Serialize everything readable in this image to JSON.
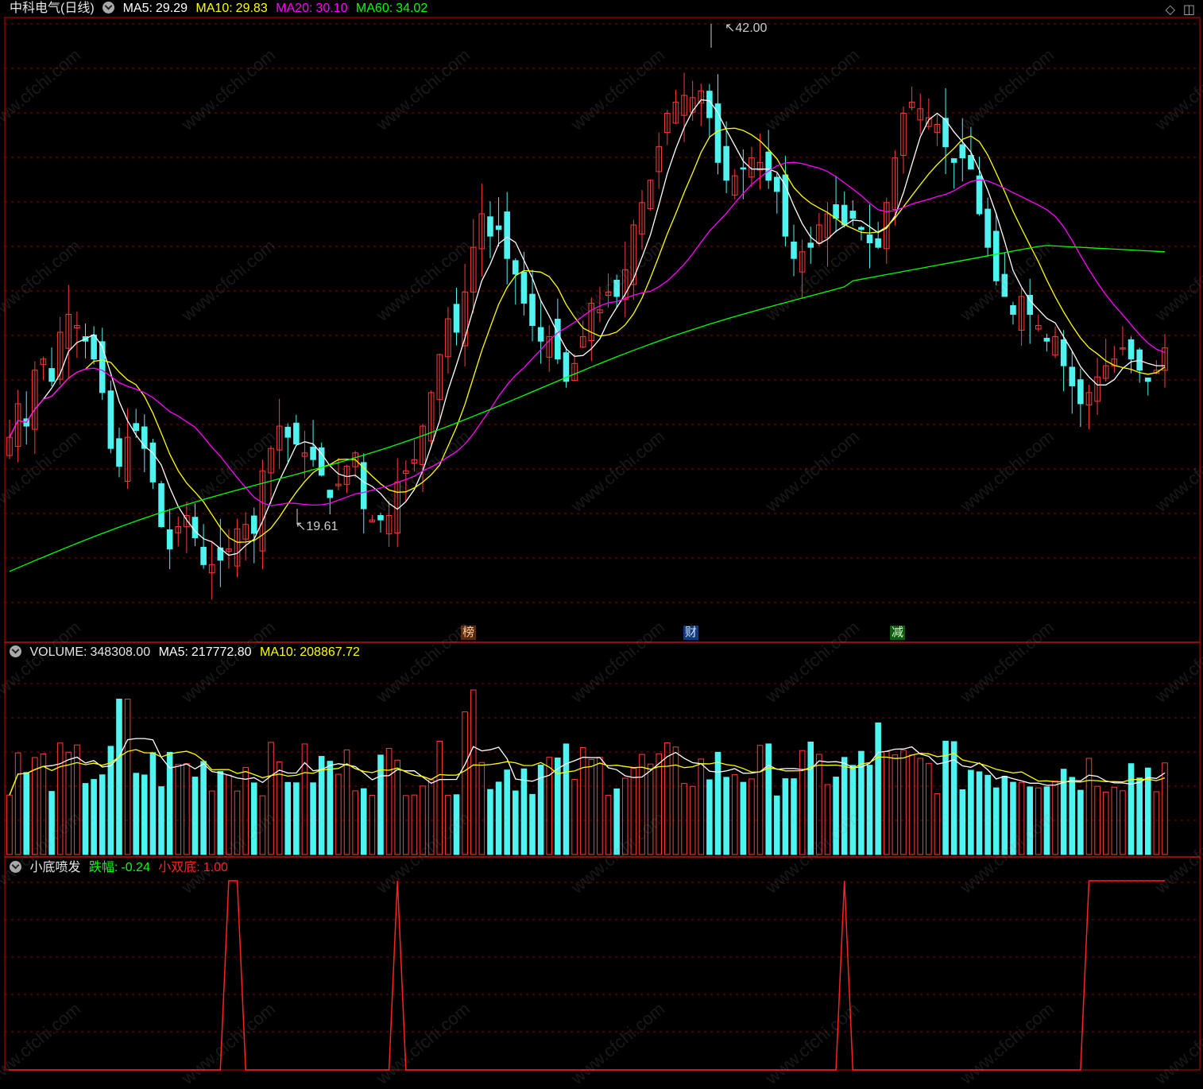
{
  "stock": {
    "title": "中科电气(日线)",
    "ma5_label": "MA5:",
    "ma5_value": "29.29",
    "ma10_label": "MA10:",
    "ma10_value": "29.83",
    "ma20_label": "MA20:",
    "ma20_value": "30.10",
    "ma60_label": "MA60:",
    "ma60_value": "34.02"
  },
  "volume": {
    "label": "VOLUME:",
    "value": "348308.00",
    "ma5_label": "MA5:",
    "ma5_value": "217772.80",
    "ma10_label": "MA10:",
    "ma10_value": "208867.72"
  },
  "indicator": {
    "name": "小底喷发",
    "drop_label": "跌幅:",
    "drop_value": "-0.24",
    "double_label": "小双底:",
    "double_value": "1.00"
  },
  "annotations": {
    "high": "42.00",
    "low": "19.61",
    "tag1": "榜",
    "tag2": "财",
    "tag3": "减"
  },
  "watermark": "www.cfchi.com",
  "colors": {
    "up": "#ff3a3a",
    "down": "#4ef4f0",
    "ma5": "#ffffff",
    "ma10": "#ffff00",
    "ma20": "#ff00ff",
    "ma60": "#00ff00",
    "grid": "#8b0000",
    "signal": "#ff2020"
  },
  "chart_data": {
    "type": "candlestick",
    "price_range": [
      19.61,
      42.0
    ],
    "closes": [
      25.5,
      27.0,
      26.0,
      28.5,
      29.0,
      28.0,
      30.2,
      31.0,
      30.5,
      29.8,
      29.0,
      27.5,
      25.0,
      24.2,
      25.5,
      25.8,
      25.0,
      23.5,
      21.5,
      20.5,
      21.5,
      22.0,
      21.0,
      19.8,
      19.8,
      20.0,
      20.5,
      21.4,
      21.6,
      21.2,
      24.0,
      25.0,
      26.0,
      25.5,
      25.2,
      24.8,
      24.5,
      23.8,
      22.8,
      23.4,
      24.2,
      24.8,
      22.3,
      21.8,
      21.8,
      22.0,
      23.5,
      24.0,
      24.5,
      26.0,
      27.5,
      29.2,
      30.8,
      30.2,
      32.0,
      34.0,
      35.5,
      34.5,
      34.8,
      33.5,
      32.8,
      31.5,
      30.5,
      29.8,
      30.0,
      29.0,
      28.0,
      28.8,
      30.0,
      31.5,
      31.2,
      32.0,
      31.8,
      33.0,
      35.0,
      36.0,
      37.0,
      38.5,
      40.0,
      40.5,
      40.8,
      40.7,
      41.0,
      39.8,
      37.8,
      37.0,
      37.2,
      37.5,
      38.0,
      37.8,
      37.0,
      36.5,
      34.5,
      33.5,
      33.8,
      34.0,
      35.0,
      35.5,
      35.3,
      35.0,
      35.3,
      34.8,
      34.2,
      34.0,
      36.0,
      38.0,
      40.0,
      40.5,
      40.2,
      39.8,
      39.5,
      38.5,
      37.8,
      38.0,
      37.5,
      35.5,
      34.0,
      32.5,
      31.8,
      31.0,
      31.8,
      31.0,
      30.5,
      29.8,
      30.0,
      28.7,
      27.8,
      27.0,
      27.5,
      28.2,
      28.7,
      29.0,
      29.5,
      29.0,
      28.5,
      28.0,
      28.5,
      29.5
    ]
  }
}
